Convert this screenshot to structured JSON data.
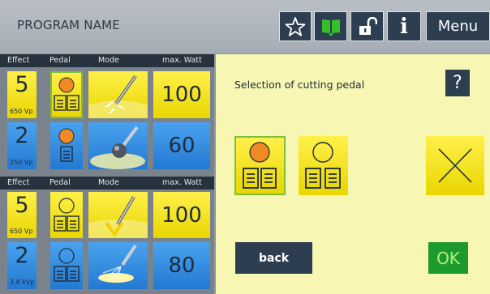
{
  "header": {
    "program_name": "PROGRAM NAME",
    "menu_label": "Menu",
    "info_label": "i",
    "icons": [
      "star-icon",
      "book-icon",
      "unlock-icon",
      "info-icon"
    ]
  },
  "left_panel": {
    "groups": [
      {
        "columns": [
          "Effect",
          "Pedal",
          "Mode",
          "max. Watt"
        ],
        "rows": [
          {
            "effect": "5",
            "voltage": "650 Vp",
            "watt": "100",
            "color": "yellow",
            "pedal_icon": "cut-pedal-double-filled-icon",
            "mode_icon": "needle-cut-icon"
          },
          {
            "effect": "2",
            "voltage": "250 Vp",
            "watt": "60",
            "color": "blue",
            "pedal_icon": "coag-pedal-single-filled-icon",
            "mode_icon": "ball-electrode-icon"
          }
        ]
      },
      {
        "columns": [
          "Effect",
          "Pedal",
          "Mode",
          "max. Watt"
        ],
        "rows": [
          {
            "effect": "5",
            "voltage": "650 Vp",
            "watt": "100",
            "color": "yellow",
            "pedal_icon": "cut-pedal-double-empty-icon",
            "mode_icon": "needle-blend-icon"
          },
          {
            "effect": "2",
            "voltage": "3.8 kVp",
            "watt": "80",
            "color": "blue",
            "pedal_icon": "coag-pedal-double-empty-icon",
            "mode_icon": "spray-coag-icon"
          }
        ]
      }
    ]
  },
  "dialog": {
    "title": "Selection of cutting pedal",
    "help_label": "?",
    "options": [
      "pedal-double-filled-icon",
      "pedal-double-empty-icon",
      "no-pedal-x-icon"
    ],
    "back_label": "back",
    "ok_label": "OK"
  },
  "colors": {
    "yellow": "#f5e21a",
    "blue": "#338fe0",
    "dark_button": "#2d3e50",
    "ok_green": "#1d9a2e",
    "panel_yellow": "#f7f7b3",
    "selection_green": "#7fbf3f"
  }
}
